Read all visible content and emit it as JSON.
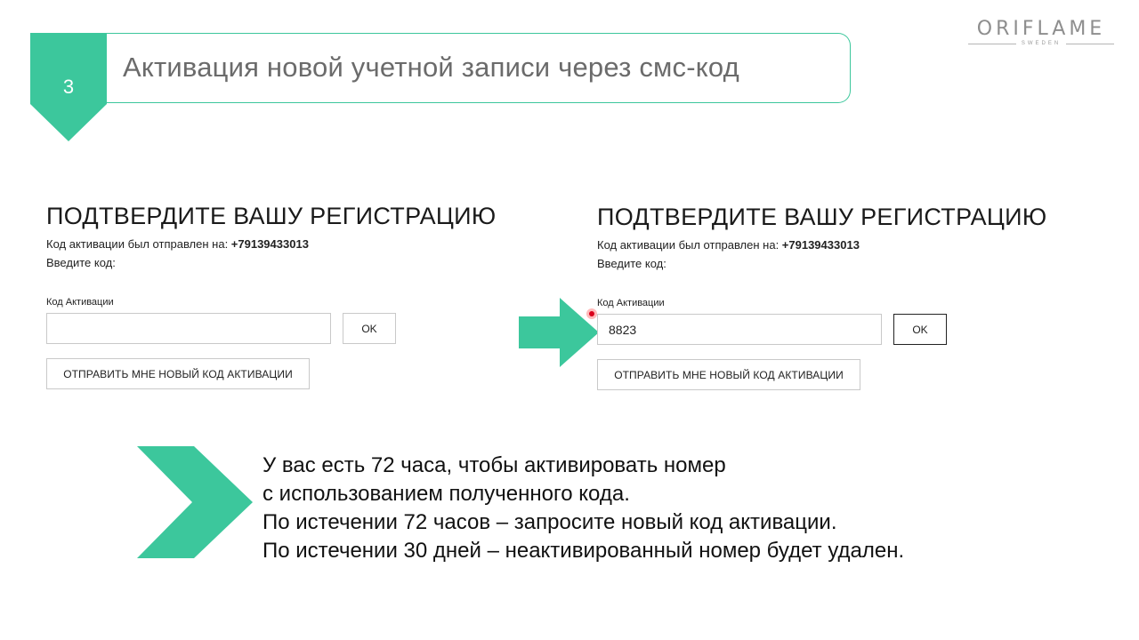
{
  "header": {
    "step_number": "3",
    "title": "Активация новой учетной записи через смс-код",
    "logo_main": "ORIFLAME",
    "logo_sub": "SWEDEN"
  },
  "forms": [
    {
      "heading": "ПОДТВЕРДИТЕ ВАШУ РЕГИСТРАЦИЮ",
      "sent_prefix": "Код активации был отправлен на: ",
      "phone": "+79139433013",
      "enter_code": "Введите код:",
      "field_label": "Код Активации",
      "input_value": "",
      "ok_label": "OK",
      "resend_label": "ОТПРАВИТЬ МНЕ НОВЫЙ КОД АКТИВАЦИИ"
    },
    {
      "heading": "ПОДТВЕРДИТЕ ВАШУ РЕГИСТРАЦИЮ",
      "sent_prefix": "Код активации был отправлен на: ",
      "phone": "+79139433013",
      "enter_code": "Введите код:",
      "field_label": "Код Активации",
      "input_value": "8823",
      "ok_label": "OK",
      "resend_label": "ОТПРАВИТЬ МНЕ НОВЫЙ КОД АКТИВАЦИИ"
    }
  ],
  "info": {
    "lines": [
      "У вас есть 72 часа, чтобы активировать номер",
      "с использованием полученного кода.",
      "По истечении 72 часов – запросите новый код активации.",
      "По истечении 30 дней – неактивированный номер будет удален."
    ]
  },
  "colors": {
    "accent": "#3cc79c",
    "title_text": "#6b6b6b",
    "cursor": "#d9001b"
  },
  "icons": {
    "step_badge": "pennant-down-badge",
    "pointer_arrow": "arrow-right-icon",
    "info_chevron": "chevron-right-icon",
    "cursor": "click-cursor-icon"
  }
}
